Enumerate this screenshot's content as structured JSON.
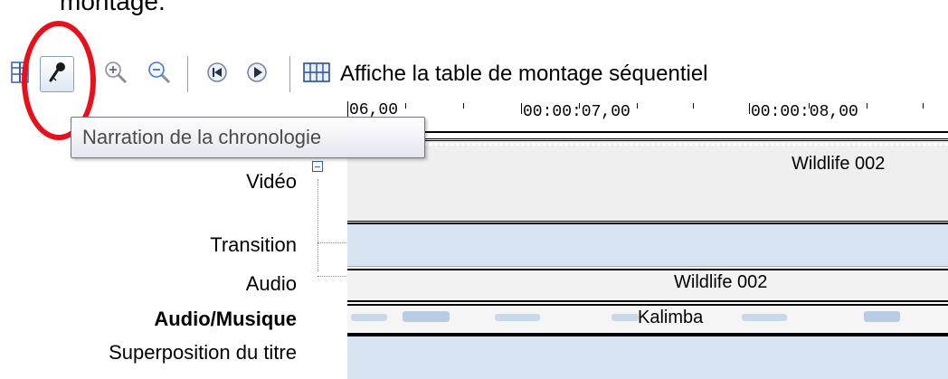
{
  "header_text": "montage.",
  "toolbar": {
    "storyboard_label": "Affiche la table de montage séquentiel",
    "buttons": [
      {
        "name": "timeline-view-icon",
        "interactable": true
      },
      {
        "name": "narration-microphone-icon",
        "interactable": true
      },
      {
        "name": "zoom-in-icon",
        "interactable": true
      },
      {
        "name": "zoom-out-icon",
        "interactable": true
      },
      {
        "name": "rewind-icon",
        "interactable": true
      },
      {
        "name": "play-icon",
        "interactable": true
      },
      {
        "name": "storyboard-icon",
        "interactable": true
      }
    ]
  },
  "tooltip": {
    "text": "Narration de la chronologie"
  },
  "ruler": {
    "labels": [
      "06,00",
      "00:00:07,00",
      "00:00:08,00"
    ]
  },
  "tracks": {
    "video": {
      "label": "Vidéo",
      "clip": "Wildlife 002"
    },
    "transition": {
      "label": "Transition"
    },
    "audio": {
      "label": "Audio",
      "clip": "Wildlife 002"
    },
    "music": {
      "label": "Audio/Musique",
      "clip": "Kalimba"
    },
    "title": {
      "label": "Superposition du titre"
    }
  },
  "colors": {
    "highlight_circle": "#e8101a",
    "track_blue": "#d8e4f2",
    "track_gray": "#efefef"
  }
}
